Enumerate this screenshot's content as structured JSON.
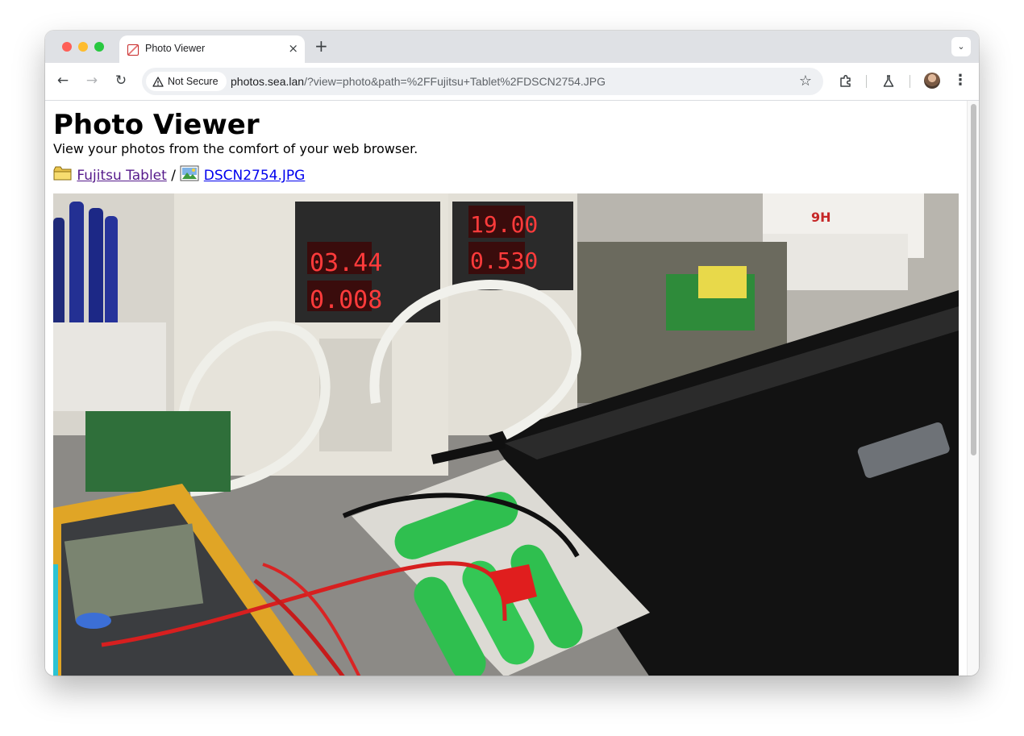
{
  "browser": {
    "tab_title": "Photo Viewer",
    "tab_close": "×",
    "new_tab": "+",
    "security_chip": "Not Secure",
    "url_host": "photos.sea.lan",
    "url_path": "/?view=photo&path=%2FFujitsu+Tablet%2FDSCN2754.JPG"
  },
  "page": {
    "title": "Photo Viewer",
    "subtitle": "View your photos from the comfort of your web browser.",
    "breadcrumb": {
      "folder_label": "Fujitsu Tablet",
      "separator": "/",
      "file_label": "DSCN2754.JPG"
    },
    "photo_alt": "DSCN2754.JPG"
  },
  "colors": {
    "link": "#0000ee",
    "visited_link": "#551a8b",
    "laptop": "#141414",
    "battery_green": "#2fbf4f"
  }
}
